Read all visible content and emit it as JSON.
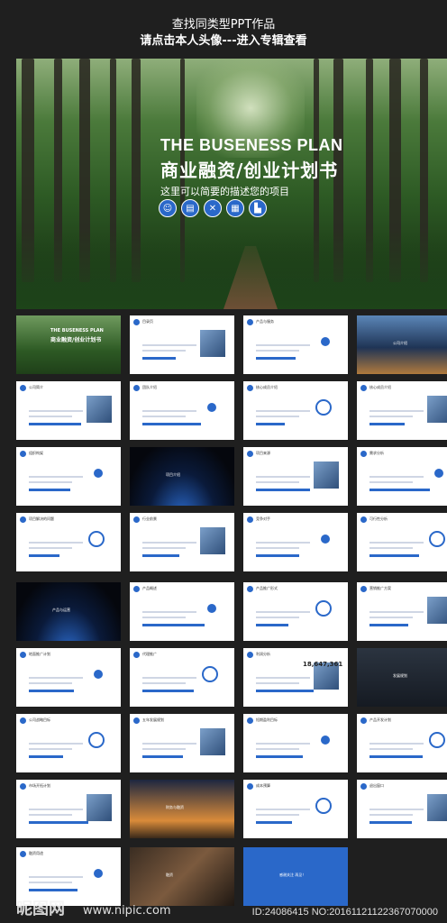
{
  "header": {
    "line1": "查找同类型PPT作品",
    "line2": "请点击本人头像---进入专辑查看"
  },
  "hero": {
    "title_en": "THE BUSENESS PLAN",
    "title_cn": "商业融资/创业计划书",
    "description": "这里可以简要的描述您的项目",
    "icons": [
      "team-icon",
      "chart-icon",
      "tools-icon",
      "calendar-icon",
      "building-icon"
    ]
  },
  "thumbnails": [
    {
      "label": "",
      "theme": "forest"
    },
    {
      "label": "目录页",
      "theme": "toc"
    },
    {
      "label": "产品与服务",
      "theme": "toc2"
    },
    {
      "label": "公司介绍",
      "theme": "city"
    },
    {
      "label": "公司简介",
      "theme": "intro"
    },
    {
      "label": "团队介绍",
      "theme": "team"
    },
    {
      "label": "核心成员介绍",
      "theme": "member"
    },
    {
      "label": "核心成员介绍",
      "theme": "member2"
    },
    {
      "label": "组织构架",
      "theme": "org"
    },
    {
      "label": "项目介绍",
      "theme": "space"
    },
    {
      "label": "项目来源",
      "theme": "source"
    },
    {
      "label": "需求分析",
      "theme": "needs"
    },
    {
      "label": "项目解决的问题",
      "theme": "arrows"
    },
    {
      "label": "行业前景",
      "theme": "prospect"
    },
    {
      "label": "竞争对手",
      "theme": "rival"
    },
    {
      "label": "可行性分析",
      "theme": "feasible"
    },
    {
      "label": "产品与运营",
      "theme": "planet"
    },
    {
      "label": "产品概述",
      "theme": "product"
    },
    {
      "label": "产品推广形式",
      "theme": "promo"
    },
    {
      "label": "营销推广方案",
      "theme": "marketing"
    },
    {
      "label": "地面推广计划",
      "theme": "ground"
    },
    {
      "label": "代理推广",
      "theme": "agent"
    },
    {
      "label": "利润分析",
      "theme": "profit"
    },
    {
      "label": "发展规划",
      "theme": "maze"
    },
    {
      "label": "公司战略目标",
      "theme": "strategy"
    },
    {
      "label": "五年发展规划",
      "theme": "fiveyear"
    },
    {
      "label": "短期盈利目标",
      "theme": "short"
    },
    {
      "label": "产品开发计划",
      "theme": "devplan"
    },
    {
      "label": "市场开拓计划",
      "theme": "market"
    },
    {
      "label": "财务与融资",
      "theme": "finance"
    },
    {
      "label": "成本预算",
      "theme": "budget"
    },
    {
      "label": "退出窗口",
      "theme": "exit"
    },
    {
      "label": "融资用途",
      "theme": "usage"
    },
    {
      "label": "融资",
      "theme": "coffee"
    },
    {
      "label": "感谢关注 再见！",
      "theme": "thanks"
    }
  ],
  "profit_figure": "18,647,361",
  "watermark": {
    "site": "昵图网",
    "url": "www.nipic.com",
    "id_text": "ID:24086415 NO:20161121122367070000"
  },
  "colors": {
    "accent": "#2a68c9",
    "background": "#1f1f1f"
  }
}
